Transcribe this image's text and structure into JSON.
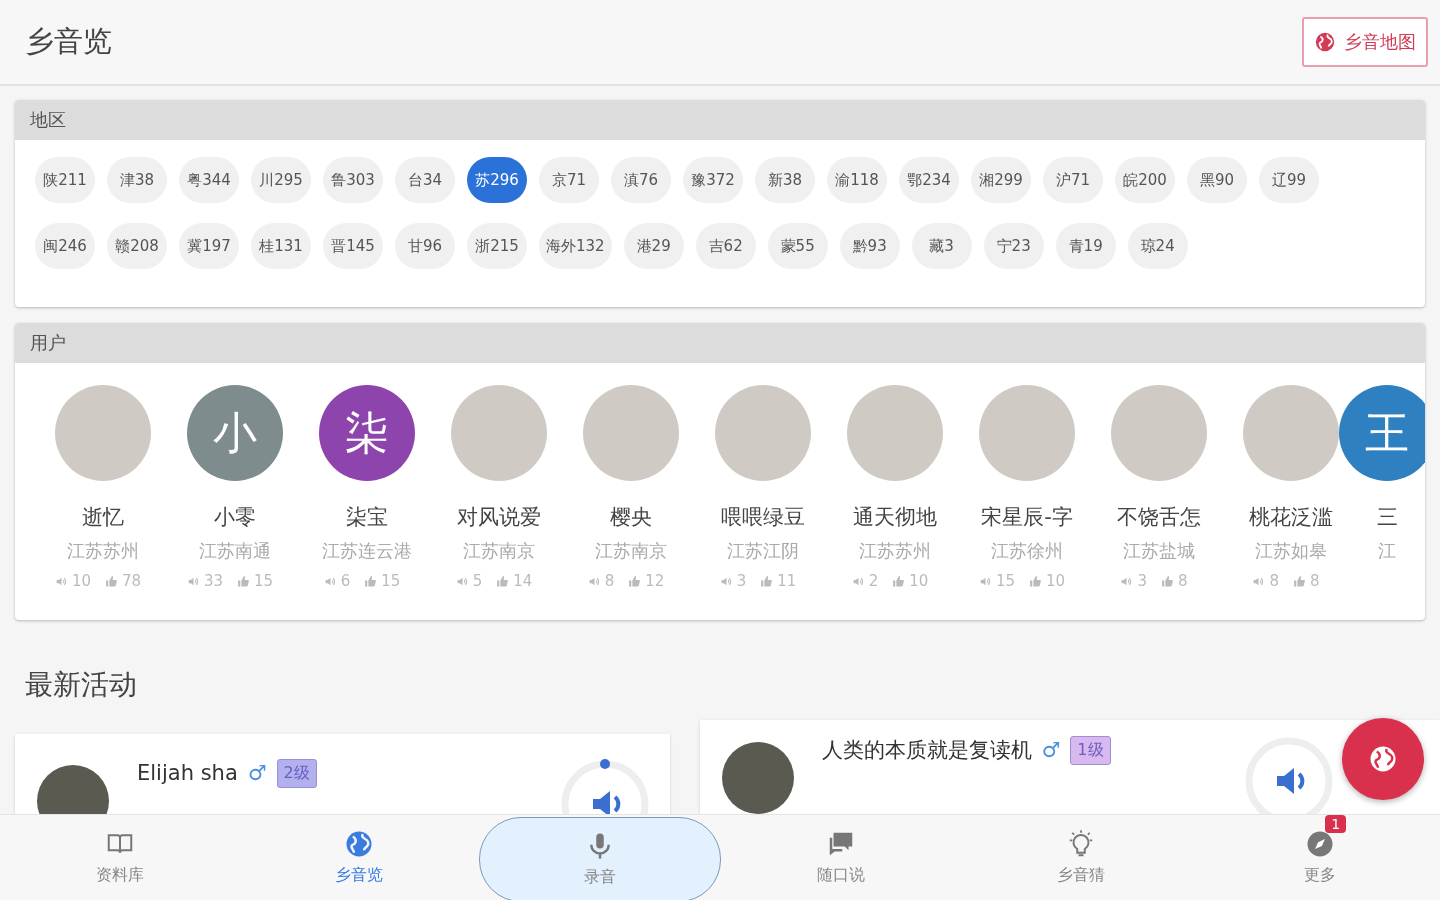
{
  "app_bar": {
    "title": "乡音览",
    "map_button": "乡音地图"
  },
  "regions": {
    "title": "地区",
    "chips": [
      {
        "label": "陕211",
        "selected": false
      },
      {
        "label": "津38",
        "selected": false
      },
      {
        "label": "粤344",
        "selected": false
      },
      {
        "label": "川295",
        "selected": false
      },
      {
        "label": "鲁303",
        "selected": false
      },
      {
        "label": "台34",
        "selected": false
      },
      {
        "label": "苏296",
        "selected": true
      },
      {
        "label": "京71",
        "selected": false
      },
      {
        "label": "滇76",
        "selected": false
      },
      {
        "label": "豫372",
        "selected": false
      },
      {
        "label": "新38",
        "selected": false
      },
      {
        "label": "渝118",
        "selected": false
      },
      {
        "label": "鄂234",
        "selected": false
      },
      {
        "label": "湘299",
        "selected": false
      },
      {
        "label": "沪71",
        "selected": false
      },
      {
        "label": "皖200",
        "selected": false
      },
      {
        "label": "黑90",
        "selected": false
      },
      {
        "label": "辽99",
        "selected": false
      },
      {
        "label": "闽246",
        "selected": false
      },
      {
        "label": "赣208",
        "selected": false
      },
      {
        "label": "冀197",
        "selected": false
      },
      {
        "label": "桂131",
        "selected": false
      },
      {
        "label": "晋145",
        "selected": false
      },
      {
        "label": "甘96",
        "selected": false
      },
      {
        "label": "浙215",
        "selected": false
      },
      {
        "label": "海外132",
        "selected": false
      },
      {
        "label": "港29",
        "selected": false
      },
      {
        "label": "吉62",
        "selected": false
      },
      {
        "label": "蒙55",
        "selected": false
      },
      {
        "label": "黔93",
        "selected": false
      },
      {
        "label": "藏3",
        "selected": false
      },
      {
        "label": "宁23",
        "selected": false
      },
      {
        "label": "青19",
        "selected": false
      },
      {
        "label": "琼24",
        "selected": false
      }
    ]
  },
  "users": {
    "title": "用户",
    "items": [
      {
        "kind": "photo",
        "name": "逝忆",
        "location": "江苏苏州",
        "recordings": "10",
        "likes": "78"
      },
      {
        "kind": "letter",
        "letter": "小",
        "color": "#7f8c8d",
        "name": "小零",
        "location": "江苏南通",
        "recordings": "33",
        "likes": "15"
      },
      {
        "kind": "letter",
        "letter": "柒",
        "color": "#8e44ad",
        "name": "柒宝",
        "location": "江苏连云港",
        "recordings": "6",
        "likes": "15"
      },
      {
        "kind": "photo",
        "name": "对风说爱",
        "location": "江苏南京",
        "recordings": "5",
        "likes": "14"
      },
      {
        "kind": "photo",
        "name": "樱央",
        "location": "江苏南京",
        "recordings": "8",
        "likes": "12"
      },
      {
        "kind": "photo",
        "name": "喂喂绿豆",
        "location": "江苏江阴",
        "recordings": "3",
        "likes": "11"
      },
      {
        "kind": "photo",
        "name": "通天彻地",
        "location": "江苏苏州",
        "recordings": "2",
        "likes": "10"
      },
      {
        "kind": "photo",
        "name": "宋星辰-字",
        "location": "江苏徐州",
        "recordings": "15",
        "likes": "10"
      },
      {
        "kind": "photo",
        "name": "不饶舌怎",
        "location": "江苏盐城",
        "recordings": "3",
        "likes": "8"
      },
      {
        "kind": "photo",
        "name": "桃花泛滥",
        "location": "江苏如皋",
        "recordings": "8",
        "likes": "8"
      },
      {
        "kind": "letter",
        "letter": "王",
        "color": "#2f80c0",
        "name": "三",
        "location": "江"
      }
    ]
  },
  "activity": {
    "title": "最新活动",
    "posts": [
      {
        "name": "Elijah sha",
        "gender": "♂",
        "level": "2级",
        "color": "#b3b0ee"
      },
      {
        "name": "人类的本质就是复读机",
        "gender": "♂",
        "level": "1级",
        "color": "#d8b8ee"
      }
    ]
  },
  "nav": [
    {
      "label": "资料库",
      "selected": false
    },
    {
      "label": "乡音览",
      "selected": true
    },
    {
      "label": "录音",
      "selected": false,
      "kind": "pill"
    },
    {
      "label": "随口说",
      "selected": false
    },
    {
      "label": "乡音猜",
      "selected": false
    },
    {
      "label": "更多",
      "selected": false,
      "badge": "1"
    }
  ]
}
